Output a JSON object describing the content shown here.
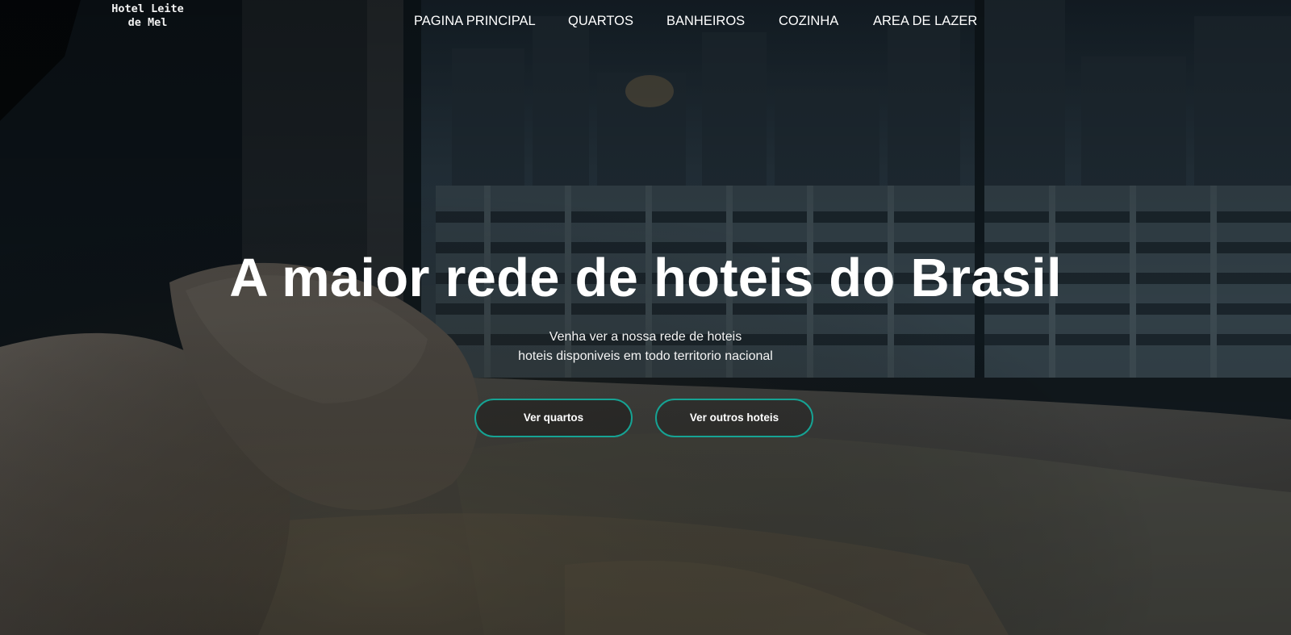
{
  "site": {
    "logo_text": "Hotel Leite\nde Mel"
  },
  "nav": {
    "items": [
      {
        "label": "PAGINA PRINCIPAL"
      },
      {
        "label": "QUARTOS"
      },
      {
        "label": "BANHEIROS"
      },
      {
        "label": "COZINHA"
      },
      {
        "label": "AREA DE LAZER"
      }
    ]
  },
  "hero": {
    "headline": "A maior rede de hoteis do Brasil",
    "subtitle_line1": "Venha ver a nossa rede de hoteis",
    "subtitle_line2": "hoteis disponiveis em todo territorio nacional",
    "buttons": [
      {
        "label": "Ver quartos"
      },
      {
        "label": "Ver outros hoteis"
      }
    ],
    "background_image": "hotel room bed with pillows in front of a window overlooking city buildings"
  },
  "colors": {
    "button_border": "#16a394",
    "text": "#ffffff",
    "overlay": "#0f1820"
  }
}
